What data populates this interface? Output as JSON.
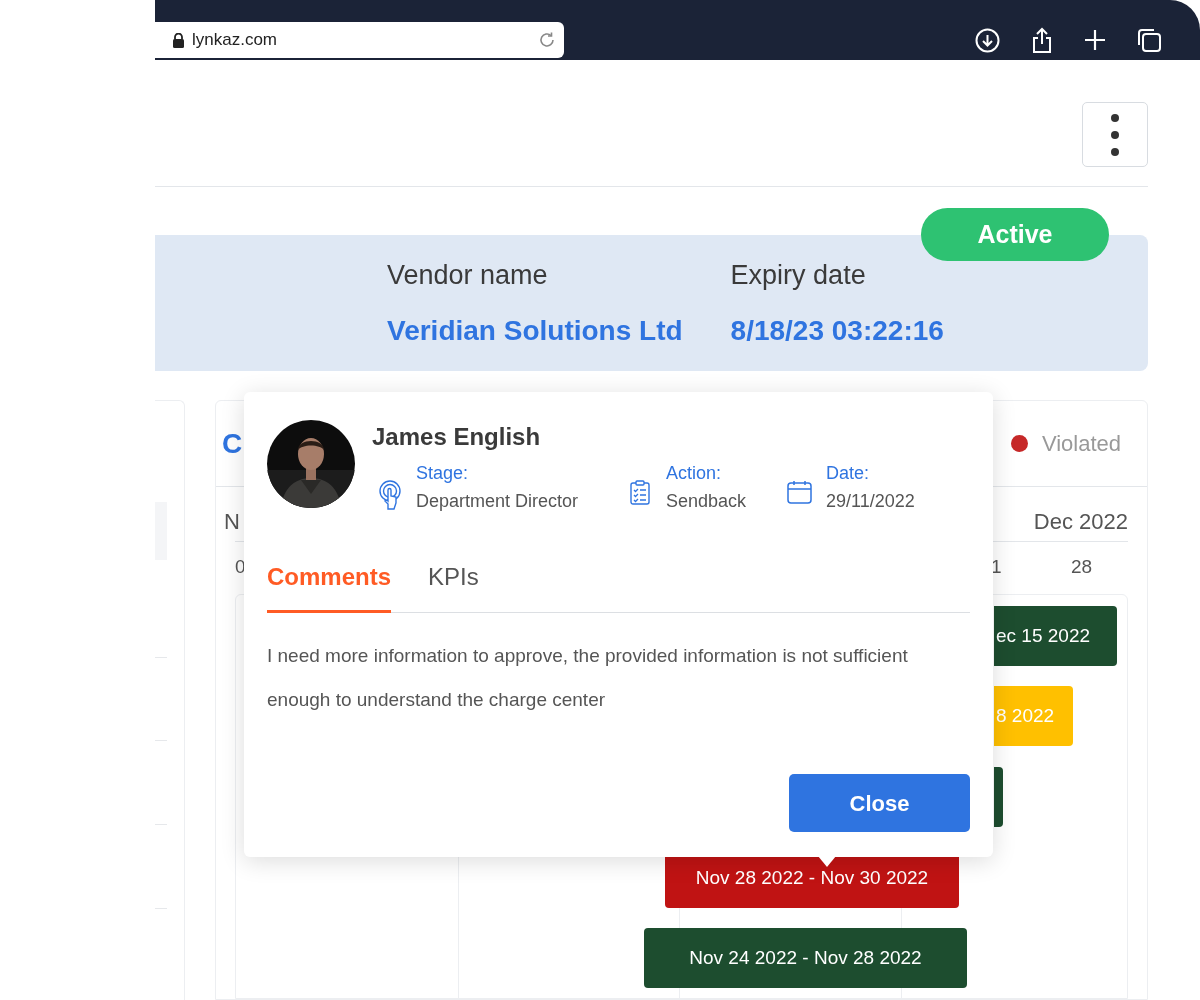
{
  "browser": {
    "url": "lynkaz.com"
  },
  "contract": {
    "status": "Active",
    "fields": [
      {
        "label": "Vendor name",
        "value": "Veridian Solutions Ltd"
      },
      {
        "label": "Expiry date",
        "value": "8/18/23 03:22:16"
      }
    ]
  },
  "timeline": {
    "title": "C",
    "legend": [
      {
        "label": "Violated",
        "color": "#c62828"
      }
    ],
    "months": [
      "N",
      "Dec 2022"
    ],
    "days": [
      "0",
      "1",
      "28"
    ],
    "bars": [
      {
        "label": "ec 15 2022",
        "color": "#1d4d2f"
      },
      {
        "label": "8 2022",
        "color": "#ffc000"
      },
      {
        "color": "#1d4d2f"
      },
      {
        "label": "Nov 28 2022 - Nov 30 2022",
        "color": "#c01313"
      },
      {
        "label": "Nov 24 2022 - Nov 28 2022",
        "color": "#1d4d2f"
      }
    ]
  },
  "popover": {
    "name": "James English",
    "meta": [
      {
        "kind": "stage",
        "label": "Stage:",
        "value": "Department Director"
      },
      {
        "kind": "action",
        "label": "Action:",
        "value": "Sendback"
      },
      {
        "kind": "date",
        "label": "Date:",
        "value": "29/11/2022"
      }
    ],
    "tabs": [
      {
        "label": "Comments",
        "selected": true
      },
      {
        "label": "KPIs",
        "selected": false
      }
    ],
    "comment": "I need more information to approve, the provided information is not sufficient enough to understand the charge center",
    "button": "Close"
  }
}
